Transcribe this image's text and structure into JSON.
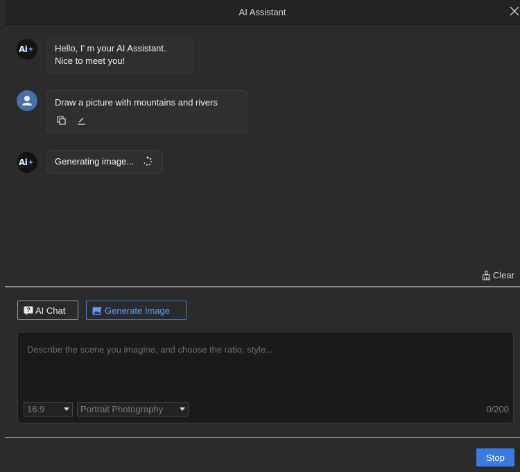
{
  "window": {
    "title": "AI Assistant"
  },
  "chat": {
    "messages": [
      {
        "role": "assistant",
        "lines": [
          "Hello, I’ m your AI Assistant.",
          "Nice to meet you!"
        ]
      },
      {
        "role": "user",
        "text": "Draw a picture with mountains and rivers"
      },
      {
        "role": "assistant",
        "text": "Generating image..."
      }
    ],
    "clear_label": "Clear"
  },
  "modes": {
    "ai_chat_label": "AI Chat",
    "generate_image_label": "Generate Image",
    "active": "generate_image"
  },
  "prompt": {
    "placeholder": "Describe the scene you imagine, and choose the ratio, style...",
    "ratio": "16:9",
    "style": "Portrait Photography",
    "counter": "0/200"
  },
  "footer": {
    "stop_label": "Stop"
  },
  "colors": {
    "accent": "#3d7be0",
    "background": "#2b2b2b"
  }
}
